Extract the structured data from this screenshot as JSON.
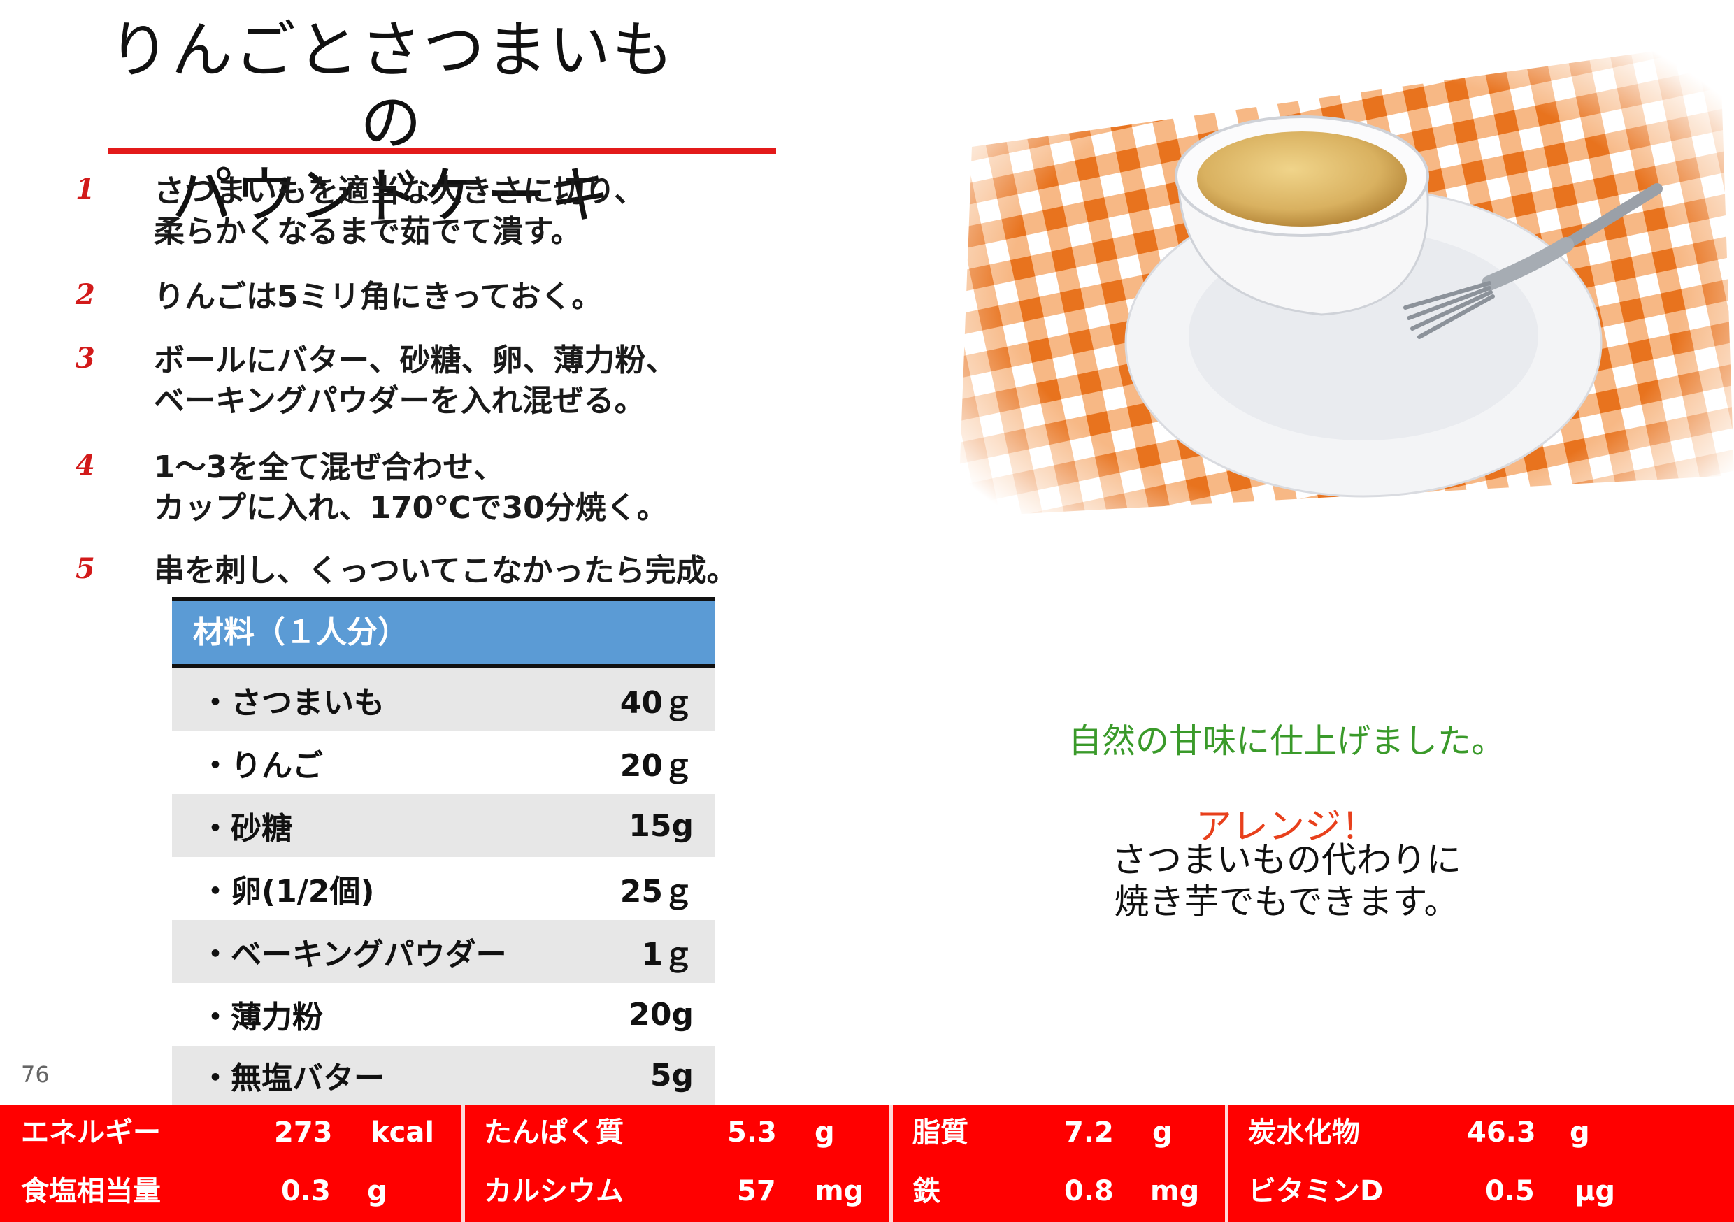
{
  "title": {
    "line1": "りんごとさつまいもの",
    "line2": "パウンドケーキ"
  },
  "steps": [
    {
      "num": "1",
      "line1": "さつまいもを適当な大きさに切り、",
      "line2": "柔らかくなるまで茹でて潰す。"
    },
    {
      "num": "2",
      "line1": "りんごは5ミリ角にきっておく。",
      "line2": ""
    },
    {
      "num": "3",
      "line1": "ボールにバター、砂糖、卵、薄力粉、",
      "line2": "ベーキングパウダーを入れ混ぜる。"
    },
    {
      "num": "4",
      "line1": "1～3を全て混ぜ合わせ、",
      "line2": "カップに入れ、170℃で30分焼く。"
    },
    {
      "num": "5",
      "line1": "串を刺し、くっついてこなかったら完成。",
      "line2": ""
    }
  ],
  "ingredients": {
    "header": "材料（１人分）",
    "items": [
      {
        "name": "・さつまいも",
        "amount": "40ｇ"
      },
      {
        "name": "・りんご",
        "amount": "20ｇ"
      },
      {
        "name": "・砂糖",
        "amount": "15g"
      },
      {
        "name": "・卵(1/2個)",
        "amount": "25ｇ"
      },
      {
        "name": "・ベーキングパウダー",
        "amount": "1ｇ"
      },
      {
        "name": "・薄力粉",
        "amount": "20g"
      },
      {
        "name": "・無塩バター",
        "amount": "5g"
      }
    ]
  },
  "page_number": "76",
  "notes": {
    "green": "自然の甘味に仕上げました。",
    "arrange_label": "アレンジ！",
    "arrange_line1": "さつまいもの代わりに",
    "arrange_line2": "焼き芋でもできます。"
  },
  "nutrition": {
    "row1": [
      {
        "label": "エネルギー",
        "value": "273",
        "unit": "kcal"
      },
      {
        "label": "たんぱく質",
        "value": "5.3",
        "unit": "g"
      },
      {
        "label": "脂質",
        "value": "7.2",
        "unit": "g"
      },
      {
        "label": "炭水化物",
        "value": "46.3",
        "unit": "g"
      }
    ],
    "row2": [
      {
        "label": "食塩相当量",
        "value": "0.3",
        "unit": "g"
      },
      {
        "label": "カルシウム",
        "value": "57",
        "unit": "mg"
      },
      {
        "label": "鉄",
        "value": "0.8",
        "unit": "mg"
      },
      {
        "label": "ビタミンD",
        "value": "0.5",
        "unit": "μg"
      }
    ]
  },
  "colors": {
    "title_rule": "#e31a1a",
    "step_number": "#d21a1a",
    "table_header": "#5b9bd5",
    "nutrition_bar": "#ff0000",
    "note_green": "#3a9a2a",
    "note_arrange": "#e8401c"
  }
}
